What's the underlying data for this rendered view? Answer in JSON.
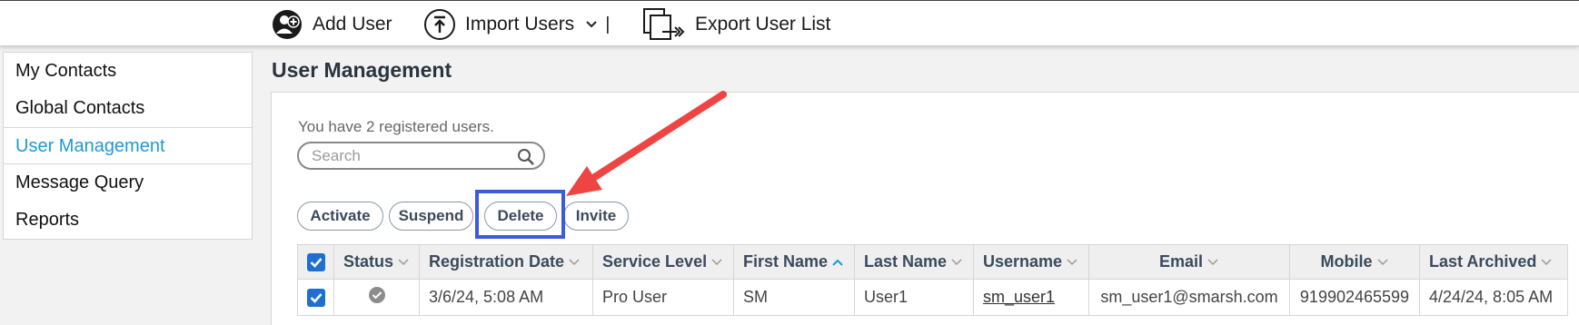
{
  "toolbar": {
    "add_user": {
      "label": "Add User",
      "icon": "add-user-icon"
    },
    "import_users": {
      "label": "Import Users",
      "icon": "import-icon",
      "separator": "|"
    },
    "export_user_list": {
      "label": "Export User List",
      "icon": "export-icon"
    }
  },
  "sidebar": {
    "items": [
      {
        "label": "My Contacts",
        "active": false
      },
      {
        "label": "Global Contacts",
        "active": false
      },
      {
        "label": "User Management",
        "active": true
      },
      {
        "label": "Message Query",
        "active": false
      },
      {
        "label": "Reports",
        "active": false
      }
    ]
  },
  "page": {
    "title": "User Management",
    "registered_text": "You have 2 registered users."
  },
  "search": {
    "placeholder": "Search",
    "value": ""
  },
  "actions": {
    "activate": "Activate",
    "suspend": "Suspend",
    "delete": "Delete",
    "invite": "Invite"
  },
  "table": {
    "columns": [
      "Status",
      "Registration Date",
      "Service Level",
      "First Name",
      "Last Name",
      "Username",
      "Email",
      "Mobile",
      "Last Archived"
    ],
    "sorted_column": "First Name",
    "rows": [
      {
        "checked": true,
        "status": "active",
        "registration_date": "3/6/24, 5:08 AM",
        "service_level": "Pro User",
        "first_name": "SM",
        "last_name": "User1",
        "username": "sm_user1",
        "email": "sm_user1@smarsh.com",
        "mobile": "919902465599",
        "last_archived": "4/24/24, 8:05 AM"
      }
    ]
  },
  "colors": {
    "accent": "#1a9bd7",
    "checkbox": "#1f6fd1",
    "highlight": "#3b5bdb",
    "annotation_arrow": "#ef4444"
  }
}
